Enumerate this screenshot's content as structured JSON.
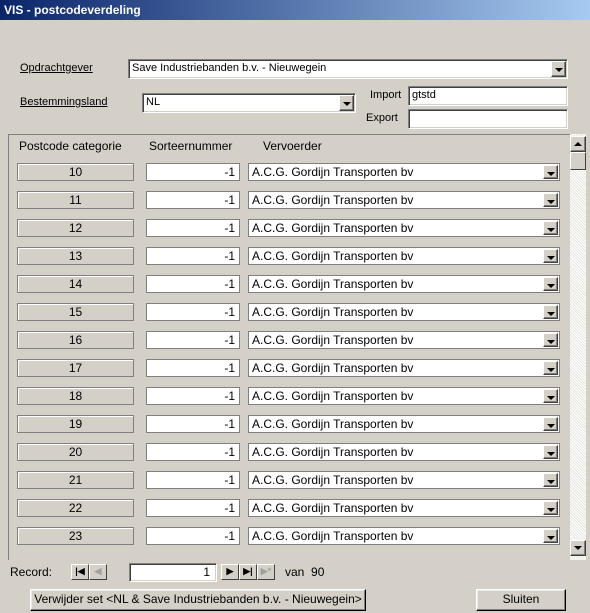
{
  "window": {
    "title": "VIS - postcodeverdeling"
  },
  "form": {
    "opdrachtgever_label": "Opdrachtgever",
    "opdrachtgever_value": "Save Industriebanden b.v. - Nieuwegein",
    "bestemmingsland_label": "Bestemmingsland",
    "bestemmingsland_value": "NL",
    "import_label": "Import",
    "import_value": "gtstd",
    "export_label": "Export",
    "export_value": ""
  },
  "grid": {
    "columns": [
      "Postcode categorie",
      "Sorteernummer",
      "Vervoerder"
    ],
    "rows": [
      {
        "cat": "10",
        "sort": "-1",
        "carrier": "A.C.G. Gordijn Transporten bv"
      },
      {
        "cat": "11",
        "sort": "-1",
        "carrier": "A.C.G. Gordijn Transporten bv"
      },
      {
        "cat": "12",
        "sort": "-1",
        "carrier": "A.C.G. Gordijn Transporten bv"
      },
      {
        "cat": "13",
        "sort": "-1",
        "carrier": "A.C.G. Gordijn Transporten bv"
      },
      {
        "cat": "14",
        "sort": "-1",
        "carrier": "A.C.G. Gordijn Transporten bv"
      },
      {
        "cat": "15",
        "sort": "-1",
        "carrier": "A.C.G. Gordijn Transporten bv"
      },
      {
        "cat": "16",
        "sort": "-1",
        "carrier": "A.C.G. Gordijn Transporten bv"
      },
      {
        "cat": "17",
        "sort": "-1",
        "carrier": "A.C.G. Gordijn Transporten bv"
      },
      {
        "cat": "18",
        "sort": "-1",
        "carrier": "A.C.G. Gordijn Transporten bv"
      },
      {
        "cat": "19",
        "sort": "-1",
        "carrier": "A.C.G. Gordijn Transporten bv"
      },
      {
        "cat": "20",
        "sort": "-1",
        "carrier": "A.C.G. Gordijn Transporten bv"
      },
      {
        "cat": "21",
        "sort": "-1",
        "carrier": "A.C.G. Gordijn Transporten bv"
      },
      {
        "cat": "22",
        "sort": "-1",
        "carrier": "A.C.G. Gordijn Transporten bv"
      },
      {
        "cat": "23",
        "sort": "-1",
        "carrier": "A.C.G. Gordijn Transporten bv"
      }
    ]
  },
  "record_nav": {
    "label": "Record:",
    "current": "1",
    "total_text": "van  90",
    "first_icon": "first-record-icon",
    "prev_icon": "previous-record-icon",
    "next_icon": "next-record-icon",
    "last_icon": "last-record-icon",
    "new_icon": "new-record-icon"
  },
  "buttons": {
    "delete_set": "Verwijder set <NL & Save Industriebanden b.v. - Nieuwegein>",
    "close": "Sluiten"
  }
}
